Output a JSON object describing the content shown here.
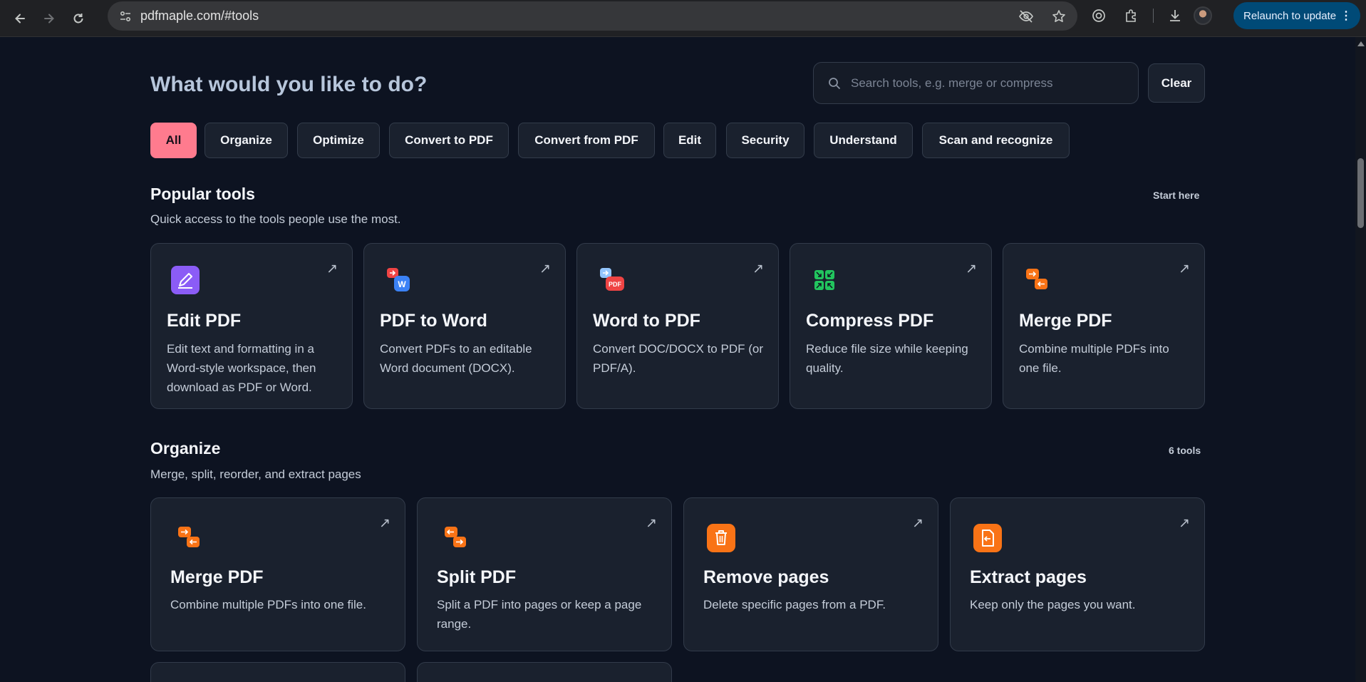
{
  "browser": {
    "url": "pdfmaple.com/#tools",
    "relaunch_label": "Relaunch to update"
  },
  "header": {
    "headline": "What would you like to do?",
    "search_placeholder": "Search tools, e.g. merge or compress",
    "search_value": "",
    "clear_label": "Clear"
  },
  "filters": [
    {
      "label": "All",
      "active": true
    },
    {
      "label": "Organize",
      "active": false
    },
    {
      "label": "Optimize",
      "active": false
    },
    {
      "label": "Convert to PDF",
      "active": false
    },
    {
      "label": "Convert from PDF",
      "active": false
    },
    {
      "label": "Edit",
      "active": false
    },
    {
      "label": "Security",
      "active": false
    },
    {
      "label": "Understand",
      "active": false
    },
    {
      "label": "Scan and recognize",
      "active": false
    }
  ],
  "popular": {
    "title": "Popular tools",
    "subtitle": "Quick access to the tools people use the most.",
    "meta": "Start here",
    "cards": [
      {
        "title": "Edit PDF",
        "desc": "Edit text and formatting in a Word-style workspace, then download as PDF or Word.",
        "icon": "edit-pdf-icon"
      },
      {
        "title": "PDF to Word",
        "desc": "Convert PDFs to an editable Word document (DOCX).",
        "icon": "pdf-to-word-icon"
      },
      {
        "title": "Word to PDF",
        "desc": "Convert DOC/DOCX to PDF (or PDF/A).",
        "icon": "word-to-pdf-icon"
      },
      {
        "title": "Compress PDF",
        "desc": "Reduce file size while keeping quality.",
        "icon": "compress-icon"
      },
      {
        "title": "Merge PDF",
        "desc": "Combine multiple PDFs into one file.",
        "icon": "merge-icon"
      }
    ]
  },
  "organize": {
    "title": "Organize",
    "subtitle": "Merge, split, reorder, and extract pages",
    "meta": "6 tools",
    "cards": [
      {
        "title": "Merge PDF",
        "desc": "Combine multiple PDFs into one file.",
        "icon": "merge-icon"
      },
      {
        "title": "Split PDF",
        "desc": "Split a PDF into pages or keep a page range.",
        "icon": "split-icon"
      },
      {
        "title": "Remove pages",
        "desc": "Delete specific pages from a PDF.",
        "icon": "trash-icon"
      },
      {
        "title": "Extract pages",
        "desc": "Keep only the pages you want.",
        "icon": "extract-icon"
      }
    ]
  },
  "arrow_glyph": "↗",
  "colors": {
    "background": "#0d1321",
    "card": "#1a212e",
    "accent_chip": "#ff7b8e",
    "headline": "#b7c6db"
  }
}
